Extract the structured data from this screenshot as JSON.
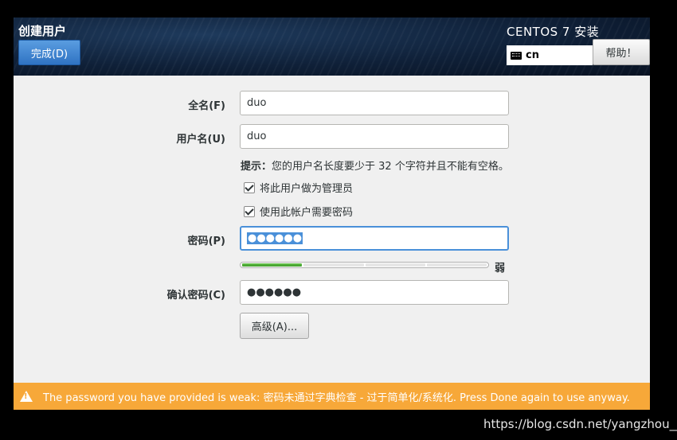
{
  "header": {
    "screen_title": "创建用户",
    "done_label": "完成(D)",
    "installer_title": "CENTOS 7 安装",
    "keyboard_layout": "cn",
    "help_label": "帮助！"
  },
  "form": {
    "fullname": {
      "label": "全名(F)",
      "value": "duo"
    },
    "username": {
      "label": "用户名(U)",
      "value": "duo"
    },
    "hint": {
      "prefix": "提示：",
      "text": "您的用户名长度要少于 32 个字符并且不能有空格。"
    },
    "admin_checkbox": {
      "label": "将此用户做为管理员",
      "checked": true
    },
    "require_password_checkbox": {
      "label": "使用此帐户需要密码",
      "checked": true
    },
    "password": {
      "label": "密码(P)",
      "value": "●●●●●●"
    },
    "strength": {
      "label": "弱",
      "level": 1,
      "max": 4,
      "color": "#4caf34"
    },
    "confirm_password": {
      "label": "确认密码(C)",
      "value": "●●●●●●"
    },
    "advanced_label": "高级(A)..."
  },
  "warning": {
    "text": "The password you have provided is weak: 密码未通过字典检查 - 过于简单化/系统化. Press Done again to use anyway.",
    "color": "#f7a839"
  },
  "watermark": "https://blog.csdn.net/yangzhou__"
}
